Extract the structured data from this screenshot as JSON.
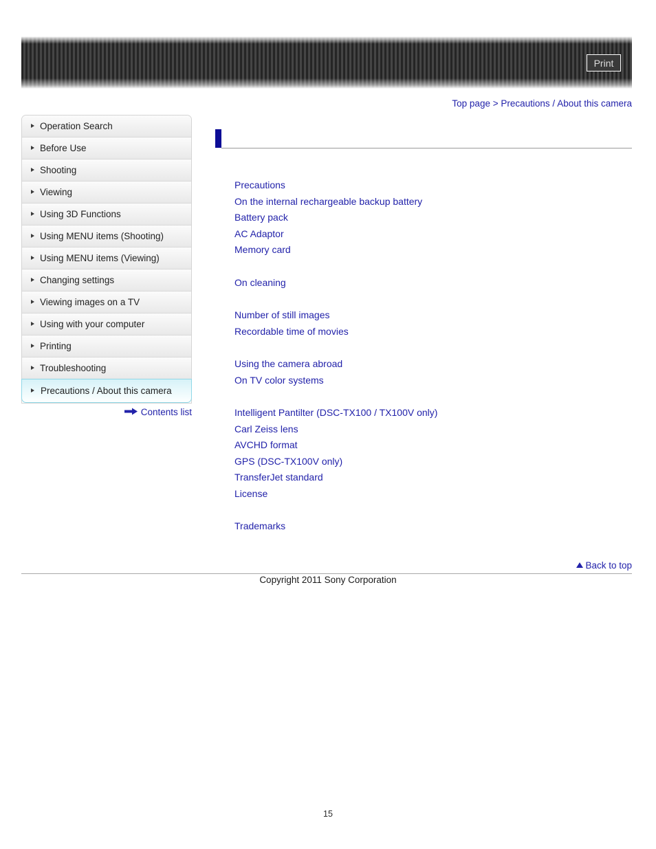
{
  "header": {
    "print_label": "Print"
  },
  "breadcrumb": {
    "top_page": "Top page",
    "separator": ">",
    "current": "Precautions / About this camera",
    "full": "Top page > Precautions / About this camera"
  },
  "sidebar": {
    "items": [
      {
        "label": "Operation Search",
        "active": false
      },
      {
        "label": "Before Use",
        "active": false
      },
      {
        "label": "Shooting",
        "active": false
      },
      {
        "label": "Viewing",
        "active": false
      },
      {
        "label": "Using 3D Functions",
        "active": false
      },
      {
        "label": "Using MENU items (Shooting)",
        "active": false
      },
      {
        "label": "Using MENU items (Viewing)",
        "active": false
      },
      {
        "label": "Changing settings",
        "active": false
      },
      {
        "label": "Viewing images on a TV",
        "active": false
      },
      {
        "label": "Using with your computer",
        "active": false
      },
      {
        "label": "Printing",
        "active": false
      },
      {
        "label": "Troubleshooting",
        "active": false
      },
      {
        "label": "Precautions / About this camera",
        "active": true
      }
    ],
    "contents_list_label": "Contents list"
  },
  "main": {
    "page_title": "",
    "link_groups": [
      {
        "links": [
          "Precautions",
          "On the internal rechargeable backup battery",
          "Battery pack",
          "AC Adaptor",
          "Memory card"
        ]
      },
      {
        "links": [
          "On cleaning"
        ]
      },
      {
        "links": [
          "Number of still images",
          "Recordable time of movies"
        ]
      },
      {
        "links": [
          "Using the camera abroad",
          "On TV color systems"
        ]
      },
      {
        "links": [
          "Intelligent Pantilter (DSC-TX100 / TX100V only)",
          "Carl Zeiss lens",
          "AVCHD format",
          "GPS (DSC-TX100V only)",
          "TransferJet standard",
          "License"
        ]
      },
      {
        "links": [
          "Trademarks"
        ]
      }
    ]
  },
  "footer": {
    "back_to_top_label": "Back to top",
    "copyright": "Copyright 2011 Sony Corporation",
    "page_number": "15"
  },
  "colors": {
    "link": "#2222aa",
    "title_marker": "#0d0d96",
    "active_item_border": "#8fd8e8",
    "banner_dark": "#252525",
    "banner_light": "#454545"
  }
}
